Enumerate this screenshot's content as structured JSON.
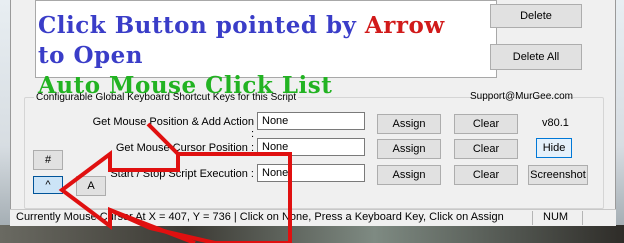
{
  "overlay": {
    "line1_prefix": "Click Button pointed by ",
    "line1_highlight": "Arrow",
    "line2": "to Open",
    "line3": "Auto Mouse Click List"
  },
  "actions_panel": {
    "delete_label": "Delete",
    "delete_all_label": "Delete All"
  },
  "shortcuts": {
    "group_title": "Configurable Global Keyboard Shortcut Keys for this Script",
    "support_email": "Support@MurGee.com",
    "version": "v80.1",
    "rows": [
      {
        "label": "Get Mouse Position & Add Action :",
        "value": "None",
        "assign": "Assign",
        "clear": "Clear"
      },
      {
        "label": "Get Mouse Cursor Position :",
        "value": "None",
        "assign": "Assign",
        "clear": "Clear"
      },
      {
        "label": "Start / Stop Script Execution :",
        "value": "None",
        "assign": "Assign",
        "clear": "Clear"
      }
    ],
    "hide_label": "Hide",
    "screenshot_label": "Screenshot"
  },
  "left_buttons": {
    "hash_label": "#",
    "caret_label": "^",
    "a_label": "A"
  },
  "statusbar": {
    "message": "Currently Mouse Cursor At X = 407, Y = 736 | Click on None, Press a Keyboard Key, Click on Assign",
    "num": "NUM"
  },
  "colors": {
    "overlay_blue": "#3a3dc8",
    "overlay_red": "#d11a1a",
    "overlay_green": "#22b322",
    "arrow": "#e01010"
  }
}
